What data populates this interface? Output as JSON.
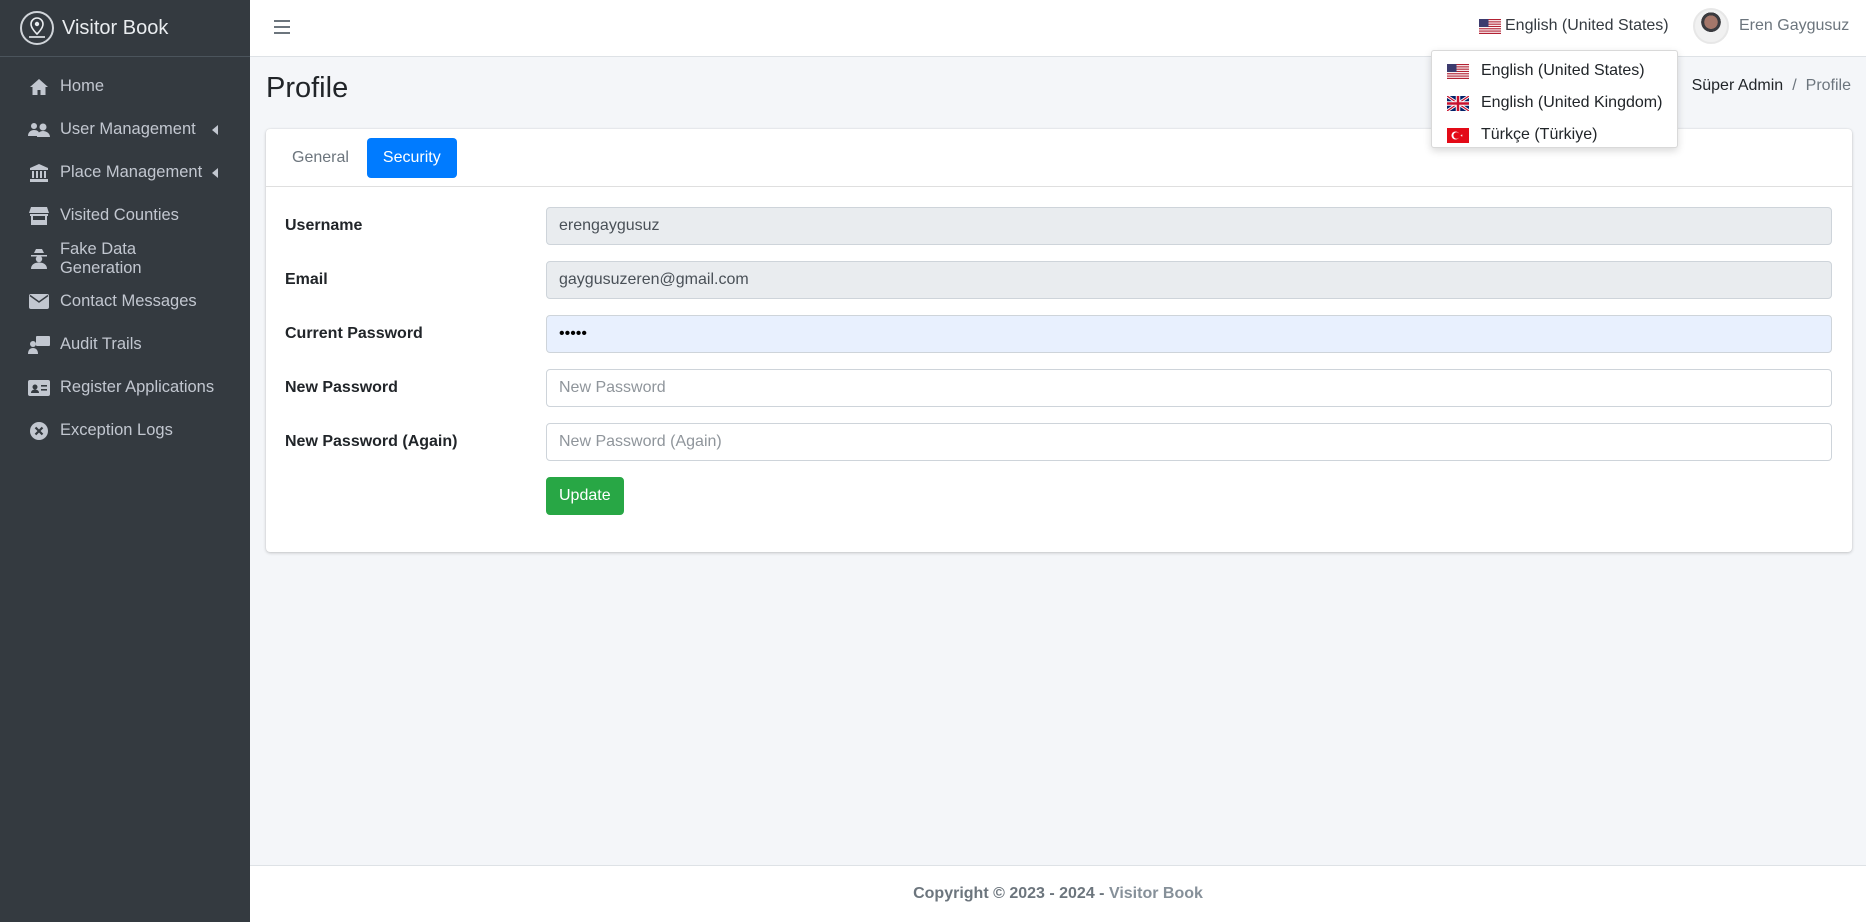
{
  "brand": {
    "name": "Visitor Book"
  },
  "sidebar": {
    "items": [
      {
        "label": "Home",
        "icon": "home-icon"
      },
      {
        "label": "User Management",
        "icon": "users-icon",
        "has_submenu": true
      },
      {
        "label": "Place Management",
        "icon": "landmark-icon",
        "has_submenu": true
      },
      {
        "label": "Visited Counties",
        "icon": "store-icon"
      },
      {
        "label": "Fake Data Generation",
        "icon": "user-secret-icon"
      },
      {
        "label": "Contact Messages",
        "icon": "envelope-icon"
      },
      {
        "label": "Audit Trails",
        "icon": "user-monitor-icon"
      },
      {
        "label": "Register Applications",
        "icon": "id-card-icon"
      },
      {
        "label": "Exception Logs",
        "icon": "times-circle-icon"
      }
    ]
  },
  "header": {
    "language": "English (United States)",
    "user_name": "Eren Gaygusuz"
  },
  "language_menu": {
    "options": [
      {
        "label": "English (United States)",
        "flag": "us-flag-icon"
      },
      {
        "label": "English (United Kingdom)",
        "flag": "uk-flag-icon"
      },
      {
        "label": "Türkçe (Türkiye)",
        "flag": "tr-flag-icon"
      }
    ]
  },
  "page": {
    "title": "Profile",
    "breadcrumb": {
      "parent": "Süper Admin",
      "current": "Profile"
    }
  },
  "tabs": [
    {
      "label": "General",
      "active": false
    },
    {
      "label": "Security",
      "active": true
    }
  ],
  "form": {
    "username": {
      "label": "Username",
      "value": "erengaygusuz"
    },
    "email": {
      "label": "Email",
      "value": "gaygusuzeren@gmail.com"
    },
    "current_password": {
      "label": "Current Password",
      "value": "•••••"
    },
    "new_password": {
      "label": "New Password",
      "placeholder": "New Password"
    },
    "new_password_again": {
      "label": "New Password (Again)",
      "placeholder": "New Password (Again)"
    },
    "submit_label": "Update"
  },
  "footer": {
    "prefix": "Copyright © 2023 - 2024 -",
    "brand": "Visitor Book"
  },
  "colors": {
    "sidebar_bg": "#343a40",
    "primary": "#007bff",
    "success": "#28a745",
    "content_bg": "#f4f6f9"
  }
}
